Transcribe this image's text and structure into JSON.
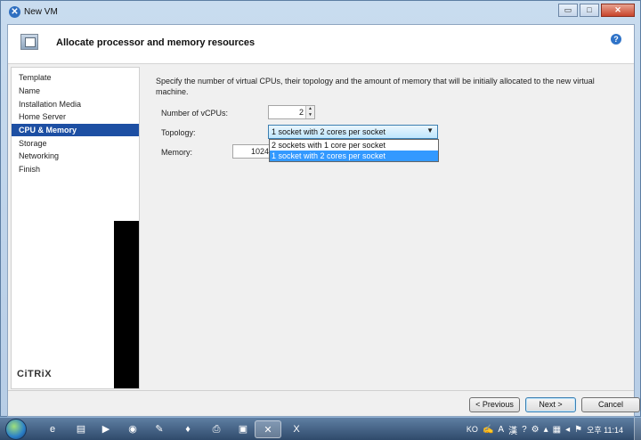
{
  "window": {
    "title": "New VM",
    "controls": {
      "minimize": "▭",
      "maximize": "□",
      "close": "✕"
    }
  },
  "header": {
    "title": "Allocate processor and memory resources",
    "help": "?"
  },
  "nav": {
    "items": [
      {
        "label": "Template",
        "active": false
      },
      {
        "label": "Name",
        "active": false
      },
      {
        "label": "Installation Media",
        "active": false
      },
      {
        "label": "Home Server",
        "active": false
      },
      {
        "label": "CPU & Memory",
        "active": true
      },
      {
        "label": "Storage",
        "active": false
      },
      {
        "label": "Networking",
        "active": false
      },
      {
        "label": "Finish",
        "active": false
      }
    ],
    "logo": "CiTRiX"
  },
  "content": {
    "description": "Specify the number of virtual CPUs, their topology and the amount of memory that will be initially allocated to the new virtual machine.",
    "vcpus_label": "Number of vCPUs:",
    "vcpus_value": "2",
    "topology_label": "Topology:",
    "topology_value": "1 socket with 2 cores per socket",
    "topology_options": [
      {
        "label": "2 sockets with 1 core per socket",
        "selected": false
      },
      {
        "label": "1 socket with 2 cores per socket",
        "selected": true
      }
    ],
    "memory_label": "Memory:",
    "memory_value": "1024"
  },
  "footer": {
    "previous": "< Previous",
    "next": "Next >",
    "cancel": "Cancel"
  },
  "taskbar": {
    "lang": "KO",
    "ime_a": "A",
    "ime_han": "漢",
    "clock": "오후 11:14",
    "active_color": "#1d4fa3"
  }
}
